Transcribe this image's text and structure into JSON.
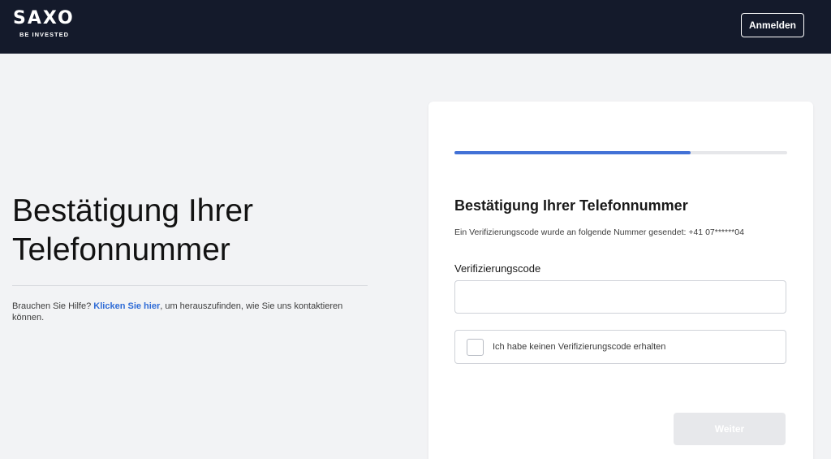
{
  "header": {
    "logo_text": "SAXO",
    "logo_tagline": "BE INVESTED",
    "login_label": "Anmelden"
  },
  "left": {
    "title_line1": "Bestätigung Ihrer",
    "title_line2": "Telefonnummer",
    "help_prefix": "Brauchen Sie Hilfe?",
    "help_link": "Klicken Sie hier",
    "help_suffix": ", um herauszufinden, wie Sie uns kontaktieren können."
  },
  "card": {
    "progress": 0.71,
    "title": "Bestätigung Ihrer Telefonnummer",
    "subtitle": "Ein Verifizierungscode wurde an folgende Nummer gesendet: +41 07******04",
    "code_label": "Verifizierungscode",
    "code_value": "",
    "code_placeholder": "",
    "no_code_label": "Ich habe keinen Verifizierungscode erhalten",
    "no_code_checked": false,
    "next_label": "Weiter"
  },
  "colors": {
    "header_bg": "#141a2b",
    "accent": "#4271d6",
    "link": "#2e6bd6",
    "page_bg": "#f2f3f5",
    "button_disabled": "#e7e8eb"
  }
}
